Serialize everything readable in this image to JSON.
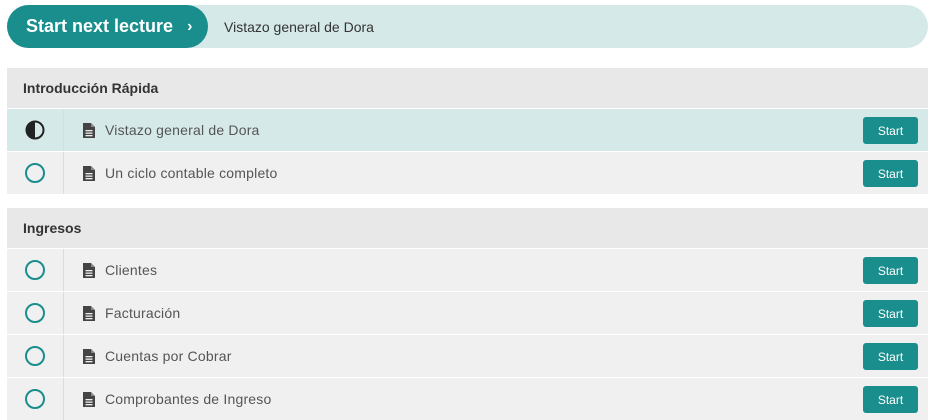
{
  "header": {
    "next_label": "Start next lecture",
    "current_lecture": "Vistazo general de Dora"
  },
  "icons": {
    "chevron": "chevron-right-icon",
    "doc": "document-icon",
    "status_half": "half-circle-icon",
    "status_empty": "empty-circle-icon"
  },
  "colors": {
    "accent": "#1a8d8d",
    "current_row": "#d6e9e9",
    "row": "#f0f0f0",
    "section_header": "#e8e8e8"
  },
  "sections": [
    {
      "title": "Introducción Rápida",
      "lectures": [
        {
          "title": "Vistazo general de Dora",
          "status": "in-progress",
          "button": "Start"
        },
        {
          "title": "Un ciclo contable completo",
          "status": "not-started",
          "button": "Start"
        }
      ]
    },
    {
      "title": "Ingresos",
      "lectures": [
        {
          "title": "Clientes",
          "status": "not-started",
          "button": "Start"
        },
        {
          "title": "Facturación",
          "status": "not-started",
          "button": "Start"
        },
        {
          "title": "Cuentas por Cobrar",
          "status": "not-started",
          "button": "Start"
        },
        {
          "title": "Comprobantes de Ingreso",
          "status": "not-started",
          "button": "Start"
        }
      ]
    }
  ]
}
